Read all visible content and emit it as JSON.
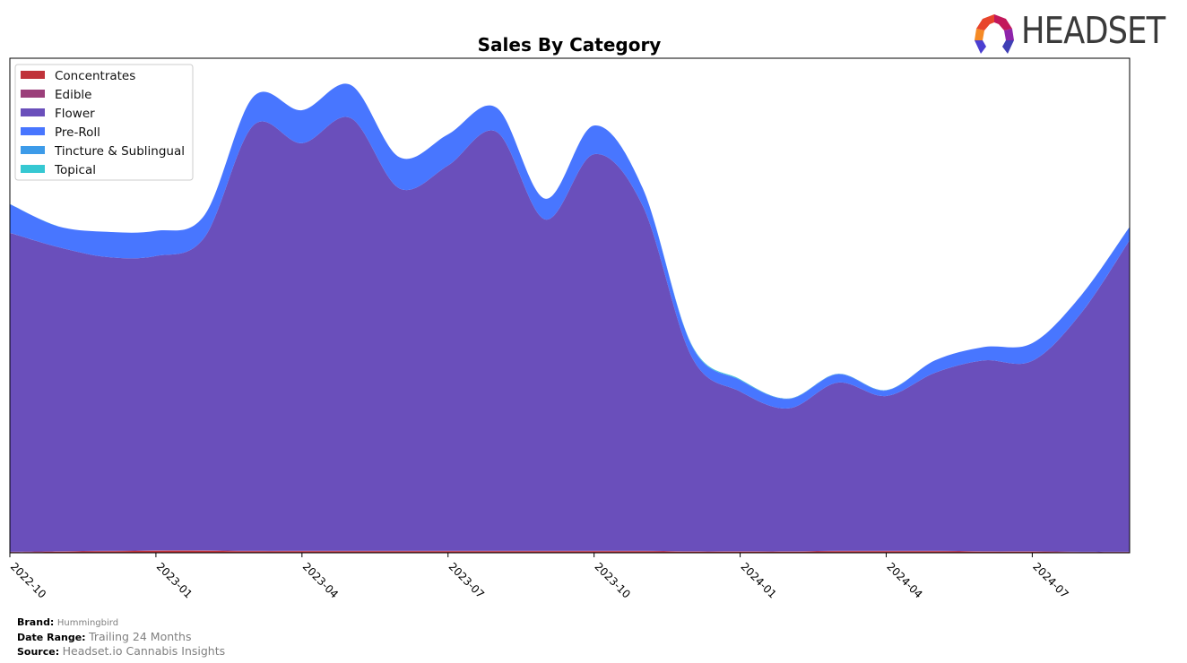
{
  "logo": {
    "text": "HEADSET",
    "colors": [
      "#e8452c",
      "#c2185b",
      "#f58a25",
      "#4b3fd1",
      "#8e24aa"
    ]
  },
  "footer": {
    "brand_label": "Brand:",
    "brand_value": "Hummingbird",
    "date_range_label": "Date Range:",
    "date_range_value": "Trailing 24 Months",
    "source_label": "Source:",
    "source_value": "Headset.io Cannabis Insights"
  },
  "chart_data": {
    "type": "area",
    "stacked": true,
    "smoothed": true,
    "title": "Sales By Category",
    "xlabel": "",
    "ylabel": "",
    "y_ticks_visible": false,
    "ylim": [
      0,
      100
    ],
    "grid": false,
    "legend_position": "top-left",
    "x": [
      "2022-10",
      "2022-11",
      "2022-12",
      "2023-01",
      "2023-02",
      "2023-03",
      "2023-04",
      "2023-05",
      "2023-06",
      "2023-07",
      "2023-08",
      "2023-09",
      "2023-10",
      "2023-11",
      "2023-12",
      "2024-01",
      "2024-02",
      "2024-03",
      "2024-04",
      "2024-05",
      "2024-06",
      "2024-07",
      "2024-08",
      "2024-09"
    ],
    "x_tick_labels": [
      "2022-10",
      "2023-01",
      "2023-04",
      "2023-07",
      "2023-10",
      "2024-01",
      "2024-04",
      "2024-07"
    ],
    "series": [
      {
        "name": "Concentrates",
        "color": "#c0333a",
        "values": [
          0.1,
          0.2,
          0.3,
          0.4,
          0.4,
          0.3,
          0.3,
          0.3,
          0.3,
          0.3,
          0.3,
          0.3,
          0.3,
          0.3,
          0.2,
          0.2,
          0.2,
          0.3,
          0.3,
          0.3,
          0.2,
          0.2,
          0.1,
          0.1
        ]
      },
      {
        "name": "Edible",
        "color": "#9b3f7a",
        "values": [
          0.1,
          0.1,
          0.1,
          0.1,
          0.1,
          0.1,
          0.1,
          0.1,
          0.1,
          0.1,
          0.1,
          0.1,
          0.1,
          0.1,
          0.1,
          0.1,
          0.1,
          0.1,
          0.1,
          0.1,
          0.1,
          0.1,
          0.1,
          0.1
        ]
      },
      {
        "name": "Flower",
        "color": "#6a4fbb",
        "values": [
          64.5,
          61.5,
          59.4,
          59.5,
          63.3,
          86.0,
          82.4,
          87.5,
          73.3,
          77.9,
          84.7,
          67.0,
          80.2,
          69.7,
          39.4,
          32.3,
          28.9,
          34.0,
          31.3,
          36.0,
          38.6,
          38.5,
          48.2,
          63.0
        ]
      },
      {
        "name": "Pre-Roll",
        "color": "#4876ff",
        "values": [
          5.8,
          4.2,
          5.1,
          5.1,
          4.5,
          5.8,
          6.7,
          6.7,
          6.3,
          6.3,
          4.9,
          4.2,
          5.8,
          3.6,
          2.3,
          2.3,
          1.9,
          1.7,
          1.1,
          2.5,
          2.7,
          3.6,
          3.6,
          2.7
        ]
      },
      {
        "name": "Tincture & Sublingual",
        "color": "#3d9be9",
        "values": [
          0,
          0,
          0,
          0,
          0,
          0,
          0,
          0,
          0,
          0,
          0,
          0,
          0,
          0,
          0.1,
          0.1,
          0.1,
          0.1,
          0.1,
          0,
          0,
          0,
          0,
          0
        ]
      },
      {
        "name": "Topical",
        "color": "#36c8d2",
        "values": [
          0,
          0,
          0,
          0,
          0,
          0,
          0,
          0,
          0,
          0,
          0,
          0,
          0,
          0,
          0.1,
          0.1,
          0,
          0,
          0,
          0,
          0,
          0,
          0,
          0
        ]
      }
    ]
  }
}
